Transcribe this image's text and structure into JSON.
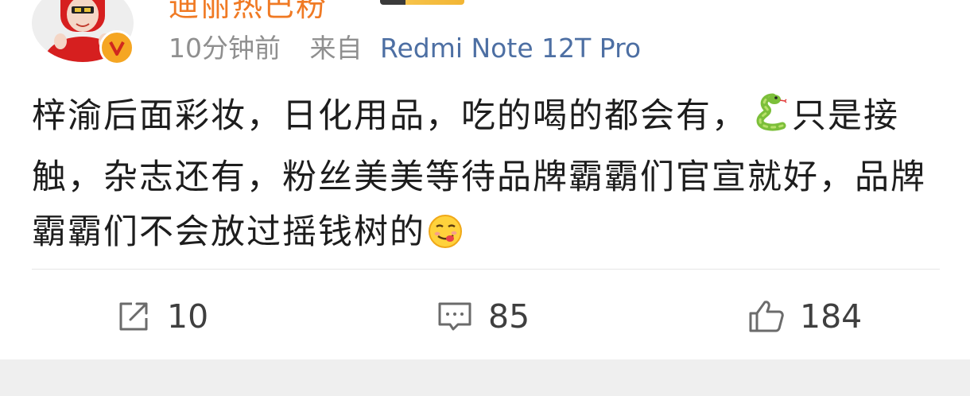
{
  "header": {
    "username": "迪丽热巴粉",
    "time": "10分钟前",
    "from_label": "来自",
    "device": "Redmi Note 12T Pro"
  },
  "post": {
    "text_part1": "梓渝后面彩妆，日化用品，吃的喝的都会有，",
    "text_part2": "只是接触，杂志还有，粉丝美美等待品牌霸霸们官宣就好，品牌霸霸们不会放过摇钱树的"
  },
  "actions": {
    "repost_count": "10",
    "comment_count": "85",
    "like_count": "184"
  },
  "icons": {
    "inline_1": "snake-emoji",
    "inline_2": "drooling-face-emoji",
    "repost": "share-icon",
    "comment": "comment-icon",
    "like": "thumbs-up-icon"
  },
  "colors": {
    "device_link": "#4d6fa3",
    "meta_gray": "#8f8f8f",
    "verified": "#f5a623",
    "username": "#f07a24"
  }
}
